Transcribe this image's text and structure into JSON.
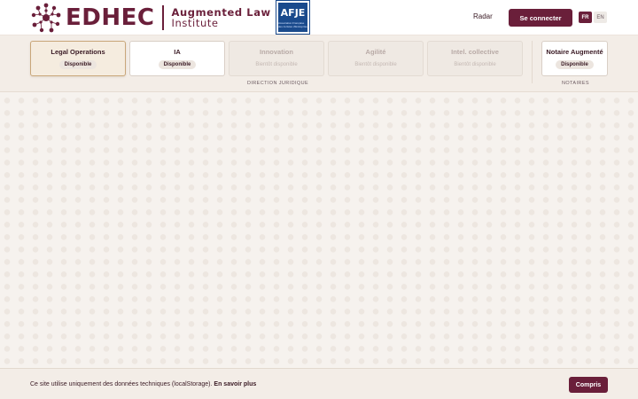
{
  "header": {
    "logo_word": "EDHEC",
    "institute_line1": "Augmented Law",
    "institute_line2": "Institute",
    "partner_logo": "AFJE",
    "partner_logo_sub": "Association Française des Juristes d'Entreprise",
    "nav_radar": "Radar",
    "login_button": "Se connecter",
    "lang_fr": "FR",
    "lang_en": "EN",
    "active_lang": "FR"
  },
  "categories": {
    "items": [
      {
        "title": "Legal Operations",
        "status": "Disponible",
        "state": "active"
      },
      {
        "title": "IA",
        "status": "Disponible",
        "state": "available"
      },
      {
        "title": "Innovation",
        "status": "Bientôt disponible",
        "state": "disabled"
      },
      {
        "title": "Agilité",
        "status": "Bientôt disponible",
        "state": "disabled"
      },
      {
        "title": "Intel. collective",
        "status": "Bientôt disponible",
        "state": "disabled"
      },
      {
        "title": "Notaire Augmenté",
        "status": "Disponible",
        "state": "available"
      }
    ],
    "group_direction": "DIRECTION JURIDIQUE",
    "group_notaires": "NOTAIRES"
  },
  "cookie": {
    "text": "Ce site utilise uniquement des données techniques (localStorage).",
    "link": "En savoir plus",
    "button": "Compris"
  },
  "colors": {
    "brand": "#6a1f3a",
    "partner_blue": "#1a4a8c",
    "active_border": "#c9a77a"
  }
}
